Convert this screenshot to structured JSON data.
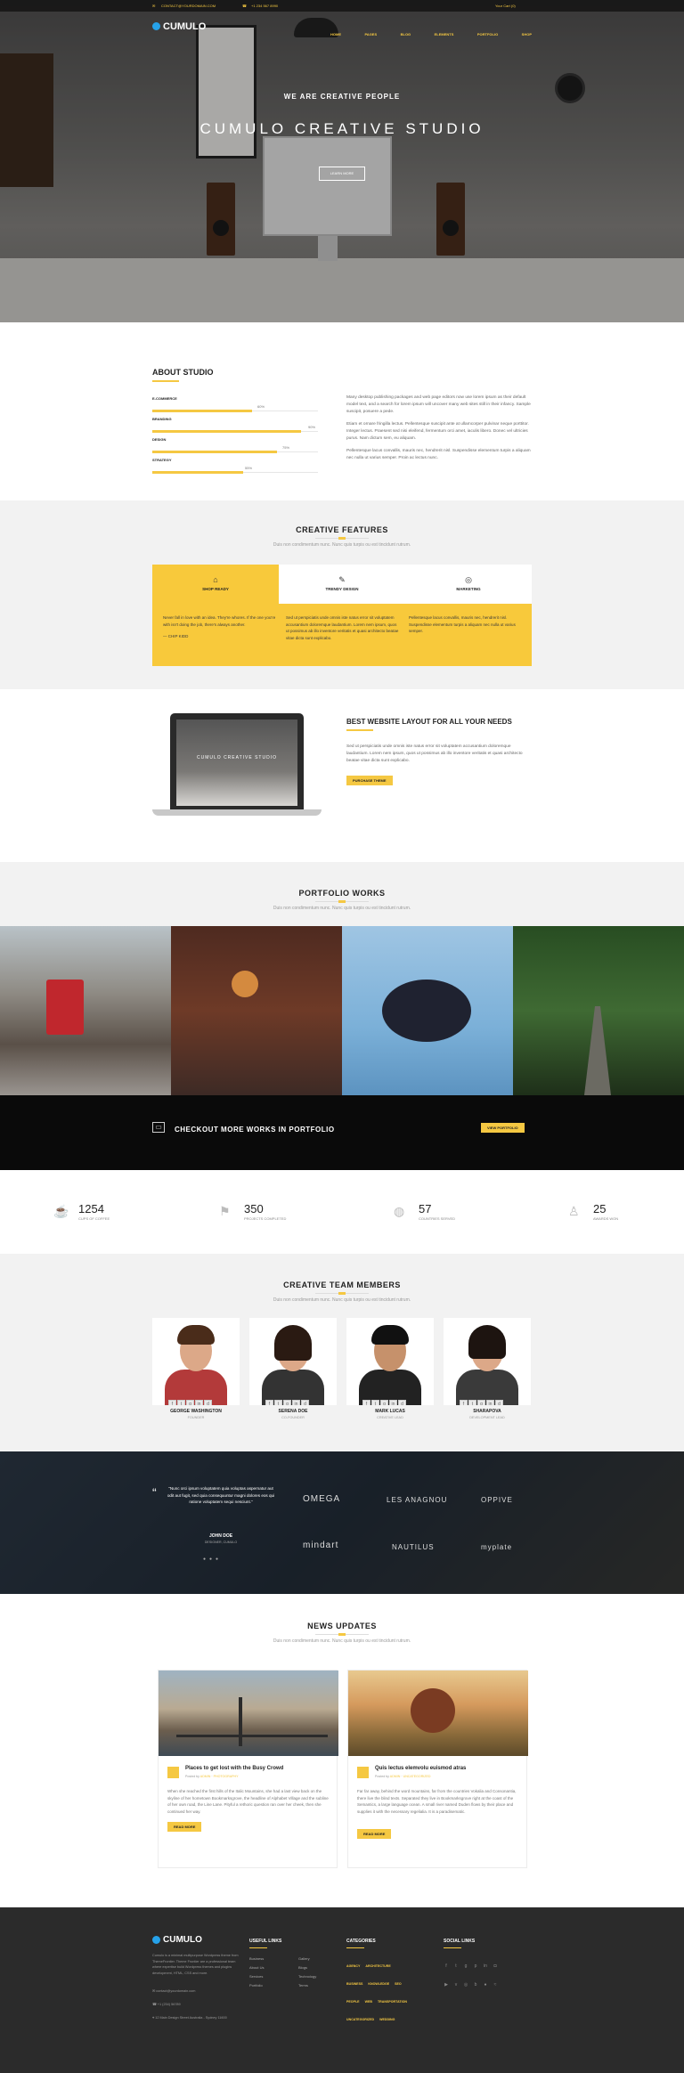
{
  "topbar": {
    "email": "CONTACT@YOURDOMAIN.COM",
    "phone": "+1 234 567 8990",
    "right": "Your Cart (0)"
  },
  "nav": {
    "logo": "CUMULO",
    "items": [
      "HOME",
      "PAGES",
      "BLOG",
      "ELEMENTS",
      "PORTFOLIO",
      "SHOP"
    ]
  },
  "hero": {
    "tagline": "WE ARE CREATIVE PEOPLE",
    "title": "CUMULO CREATIVE STUDIO",
    "button": "LEARN MORE"
  },
  "about": {
    "title": "ABOUT STUDIO",
    "skills": [
      {
        "label": "E-COMMERCE",
        "value": "60%",
        "percent": 60
      },
      {
        "label": "BRANDING",
        "value": "90%",
        "percent": 90
      },
      {
        "label": "DESIGN",
        "value": "75%",
        "percent": 75
      },
      {
        "label": "STRATEGY",
        "value": "55%",
        "percent": 55
      }
    ],
    "paragraphs": [
      "Many desktop publishing packages and web page editors now use lorem ipsum as their default model text, and a search for lorem ipsum will uncover many web sites still in their infancy. Sample suscipit, posuere a pede.",
      "Etiam et ornare fringilla lectus. Pellentesque suscipit ante at ullamcorper pulvinar neque porttitor. Integer lectus. Praesent sed nisi eleifend, fermentum orci amet, iaculis libero. Donec vel ultricies purus. Nam dictum sem, eu aliquam.",
      "Pellentesque lacus convallis, mauris nec, hendrerit nisl. Suspendisse elementum turpis a aliquam nec nulla ut varius semper. Proin ac lectus nunc."
    ]
  },
  "features": {
    "title": "CREATIVE FEATURES",
    "subtitle": "Duis non condimentum nunc. Nunc quis turpis ou est tincidunt rutrum.",
    "tabs": [
      "SHOP READY",
      "TRENDY DESIGN",
      "MARKETING"
    ],
    "columns": [
      "Never fall in love with an idea. They're whores. If the one you're with isn't doing the job, there's always another.",
      "Sed ut perspiciatis unde omnis iste natus error sit voluptatem accusantium doloremque laudantium. Lorem nem ipsum, quos ut possimus ab illo inventore veritatis et quasi architecto beatae vitae dicta sunt explicabo.",
      "Pellentesque lacus convallis, mauris nec, hendrerit nisl. Suspendisse elementum turpis a aliquam nec nulla ut varius semper."
    ],
    "quote_author": "— CHIP KIDD"
  },
  "layout": {
    "title": "BEST WEBSITE LAYOUT FOR ALL YOUR NEEDS",
    "screen_text": "CUMULO CREATIVE STUDIO",
    "text": "Sed ut perspiciatis unde omnis iste natus error sit voluptatem accusantium doloremque laudantium. Lorem nem ipsum, quos ut possimus ab illo inventore veritatis et quasi architecto beatae vitae dicta sunt explicabo.",
    "button": "PURCHASE THEME"
  },
  "portfolio": {
    "title": "PORTFOLIO WORKS",
    "subtitle": "Duis non condimentum nunc. Nunc quis turpis ou est tincidunt rutrum.",
    "cta": "CHECKOUT MORE WORKS IN PORTFOLIO",
    "button": "VIEW PORTFOLIO"
  },
  "stats": [
    {
      "num": "1254",
      "label": "CUPS OF COFFEE",
      "icon": "coffee-icon"
    },
    {
      "num": "350",
      "label": "PROJECTS COMPLETED",
      "icon": "bookmark-icon"
    },
    {
      "num": "57",
      "label": "COUNTRIES SERVED",
      "icon": "globe-icon"
    },
    {
      "num": "25",
      "label": "AWARDS WON",
      "icon": "trophy-icon"
    }
  ],
  "team": {
    "title": "CREATIVE TEAM MEMBERS",
    "subtitle": "Duis non condimentum nunc. Nunc quis turpis ou est tincidunt rutrum.",
    "members": [
      {
        "name": "GEORGE WASHINGTON",
        "role": "FOUNDER"
      },
      {
        "name": "SERENA DOE",
        "role": "CO-FOUNDER"
      },
      {
        "name": "MARK LUCAS",
        "role": "CREATIVE LEAD"
      },
      {
        "name": "SHARAPOVA",
        "role": "DEVELOPMENT LEAD"
      }
    ]
  },
  "testimonial": {
    "quote": "\"Nunc orci ipsum voluptatem quia voluptas aspernatur aut odit aut fugit, sed quia consequuntur magni dolores eos qui ratione voluptatem sequi nesciunt.\"",
    "name": "JOHN DOE",
    "role": "DESIGNER, CUMULO",
    "brands": [
      "OMEGA",
      "LES ANAGNOU",
      "OPPIVE",
      "mindart",
      "NAUTILUS",
      "myplate"
    ]
  },
  "news": {
    "title": "NEWS UPDATES",
    "subtitle": "Duis non condimentum nunc. Nunc quis turpis ou est tincidunt rutrum.",
    "posts": [
      {
        "title": "Places to get lost with the Busy Crowd",
        "meta_prefix": "Posted by",
        "author": "ADMIN",
        "category": "PHOTOGRAPHY",
        "text": "When she reached the first hills of the Italic Mountains, she had a last view back on the skyline of her hometown Bookmarksgrove, the headline of Alphabet Village and the subline of her own road, the Line Lane. Pityful a rethoric question ran over her cheek, then she continued her way.",
        "button": "READ MORE"
      },
      {
        "title": "Quis lectus elemvolu euismod atras",
        "meta_prefix": "Posted by",
        "author": "ADMIN",
        "category": "UNCATEGORIZED",
        "text": "Far far away, behind the word mountains, far from the countries Vokalia and Consonantia, there live the blind texts. Separated they live in Bookmarksgrove right at the coast of the Semantics, a large language ocean. A small river named Duden flows by their place and supplies it with the necessary regelialia. It is a paradisematic.",
        "button": "READ MORE"
      }
    ]
  },
  "footer": {
    "logo": "CUMULO",
    "about": "Cumulo is a minimal multipurpose Wordpress theme from ThemeFrontier. Theme Frontier are a professional team where expertise build Wordpress themes and plugins development, HTML, CSS and more.",
    "email": "contact@yourdomain.com",
    "phone": "+1 (234) 56789",
    "address": "12 Main Design Street Australia - Sydney 11600",
    "useful_title": "USEFUL LINKS",
    "useful_col1": [
      "Business",
      "About Us",
      "Services",
      "Portfolio"
    ],
    "useful_col2": [
      "Gallery",
      "Blogs",
      "Technology",
      "Terms"
    ],
    "cat_title": "CATEGORIES",
    "cats": [
      "AGENCY",
      "ARCHITECTURE",
      "BUSINESS",
      "KNOWLEDGE",
      "SEO",
      "PEOPLE",
      "WEB",
      "TRANSPORTATION",
      "UNCATEGORIZED",
      "WEDDING"
    ],
    "social_title": "SOCIAL LINKS"
  },
  "colors": {
    "accent": "#f5c842",
    "logo_blue": "#26a2ea",
    "dark": "#2b2b2b"
  }
}
